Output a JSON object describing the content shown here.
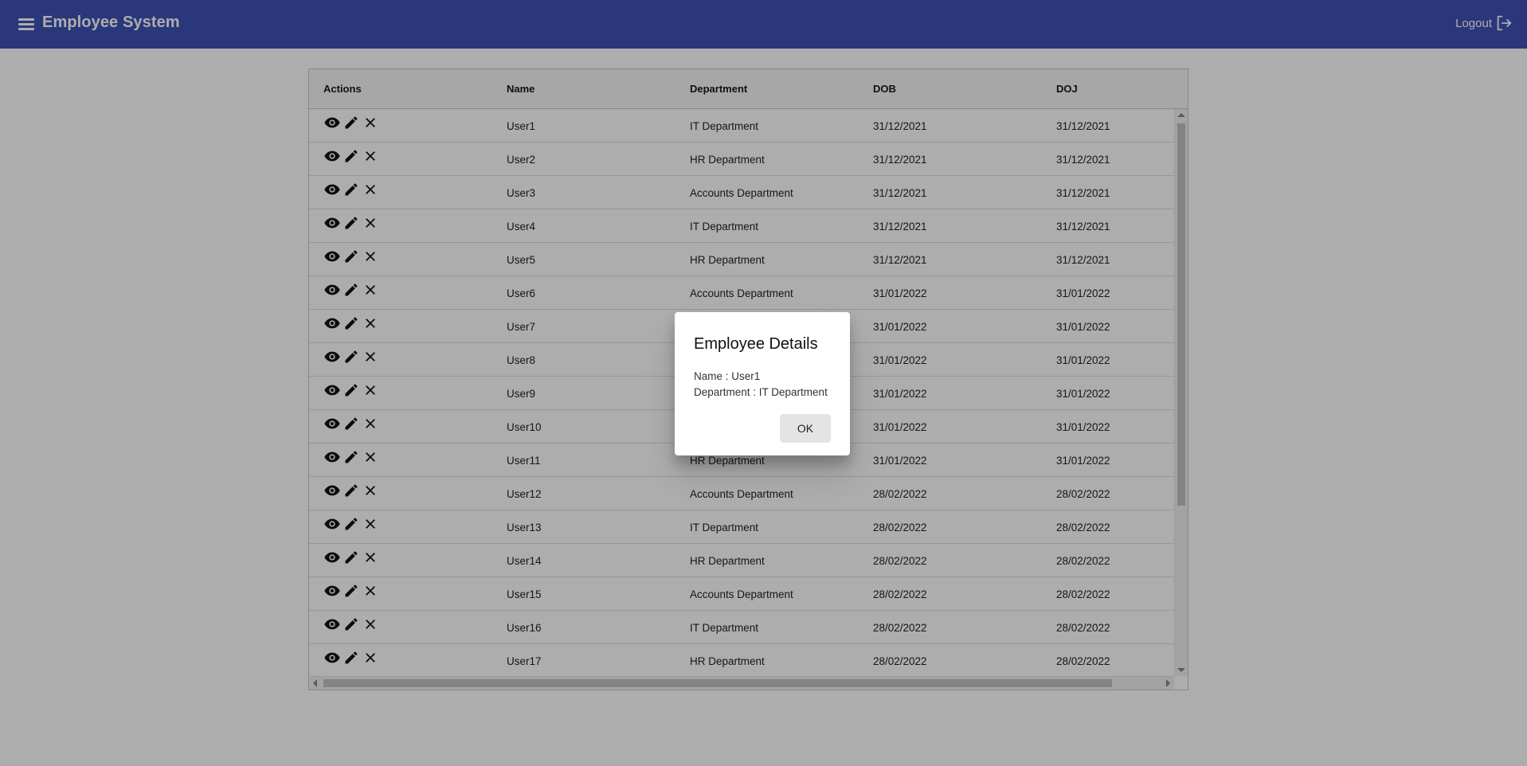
{
  "app": {
    "title": "Employee System",
    "logout_label": "Logout",
    "primary_color": "#3f51b5"
  },
  "grid": {
    "columns": [
      "Actions",
      "Name",
      "Department",
      "DOB",
      "DOJ"
    ],
    "action_icons": [
      "eye-icon",
      "pencil-icon",
      "close-icon"
    ],
    "rows": [
      {
        "name": "User1",
        "department": "IT Department",
        "dob": "31/12/2021",
        "doj": "31/12/2021"
      },
      {
        "name": "User2",
        "department": "HR Department",
        "dob": "31/12/2021",
        "doj": "31/12/2021"
      },
      {
        "name": "User3",
        "department": "Accounts Department",
        "dob": "31/12/2021",
        "doj": "31/12/2021"
      },
      {
        "name": "User4",
        "department": "IT Department",
        "dob": "31/12/2021",
        "doj": "31/12/2021"
      },
      {
        "name": "User5",
        "department": "HR Department",
        "dob": "31/12/2021",
        "doj": "31/12/2021"
      },
      {
        "name": "User6",
        "department": "Accounts Department",
        "dob": "31/01/2022",
        "doj": "31/01/2022"
      },
      {
        "name": "User7",
        "department": "",
        "dob": "31/01/2022",
        "doj": "31/01/2022"
      },
      {
        "name": "User8",
        "department": "",
        "dob": "31/01/2022",
        "doj": "31/01/2022"
      },
      {
        "name": "User9",
        "department": "",
        "dob": "31/01/2022",
        "doj": "31/01/2022"
      },
      {
        "name": "User10",
        "department": "",
        "dob": "31/01/2022",
        "doj": "31/01/2022"
      },
      {
        "name": "User11",
        "department": "HR Department",
        "dob": "31/01/2022",
        "doj": "31/01/2022"
      },
      {
        "name": "User12",
        "department": "Accounts Department",
        "dob": "28/02/2022",
        "doj": "28/02/2022"
      },
      {
        "name": "User13",
        "department": "IT Department",
        "dob": "28/02/2022",
        "doj": "28/02/2022"
      },
      {
        "name": "User14",
        "department": "HR Department",
        "dob": "28/02/2022",
        "doj": "28/02/2022"
      },
      {
        "name": "User15",
        "department": "Accounts Department",
        "dob": "28/02/2022",
        "doj": "28/02/2022"
      },
      {
        "name": "User16",
        "department": "IT Department",
        "dob": "28/02/2022",
        "doj": "28/02/2022"
      },
      {
        "name": "User17",
        "department": "HR Department",
        "dob": "28/02/2022",
        "doj": "28/02/2022"
      }
    ]
  },
  "dialog": {
    "title": "Employee Details",
    "name_line": "Name : User1",
    "department_line": "Department : IT Department",
    "ok_label": "OK"
  }
}
